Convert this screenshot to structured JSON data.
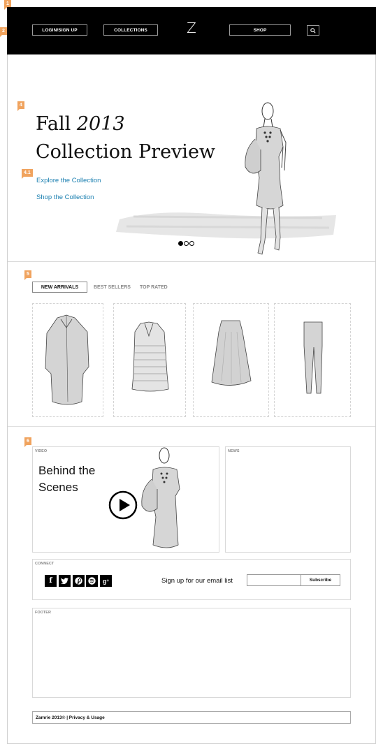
{
  "annotations": {
    "page": "1",
    "header": "2",
    "hero": "4",
    "hero_links": "4.1",
    "products": "5",
    "media": "6"
  },
  "header": {
    "login_label": "LOGIN/SIGN UP",
    "collections_label": "COLLECTIONS",
    "logo": "Z",
    "shop_label": "SHOP",
    "search_icon": "magnifier-icon"
  },
  "hero": {
    "title_prefix": "Fall ",
    "title_year": "2013",
    "title_line2": "Collection Preview",
    "explore_link": "Explore the Collection",
    "shop_link": "Shop the Collection",
    "slide_count": 3,
    "active_slide": 1
  },
  "products": {
    "tabs": [
      {
        "label": "NEW ARRIVALS",
        "active": true
      },
      {
        "label": "BEST SELLERS",
        "active": false
      },
      {
        "label": "TOP RATED",
        "active": false
      }
    ],
    "items": [
      "shirt-dress-sketch",
      "striped-tunic-sketch",
      "midi-skirt-sketch",
      "slim-pants-sketch"
    ]
  },
  "video": {
    "label": "VIDEO",
    "title_line1": "Behind the",
    "title_line2": "Scenes"
  },
  "news": {
    "label": "NEWS"
  },
  "connect": {
    "label": "CONNECT",
    "social": [
      "facebook-icon",
      "twitter-icon",
      "pinterest-icon",
      "spotify-icon",
      "google-plus-icon"
    ],
    "signup_text": "Sign up for our email list",
    "email_value": "",
    "subscribe_label": "Subscribe"
  },
  "footer": {
    "label": "FOOTER",
    "copyright": "Zamrie 2013©",
    "links": "| Privacy & Usage"
  },
  "colors": {
    "header_bg": "#000000",
    "link": "#1a7fb0",
    "annotation": "#f0a35e"
  }
}
